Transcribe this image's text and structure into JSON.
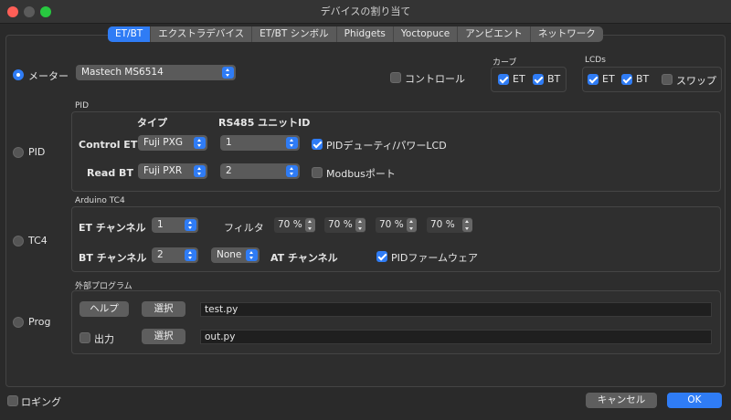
{
  "window": {
    "title": "デバイスの割り当て"
  },
  "tabs": [
    {
      "label": "ET/BT",
      "active": true
    },
    {
      "label": "エクストラデバイス"
    },
    {
      "label": "ET/BT シンボル"
    },
    {
      "label": "Phidgets"
    },
    {
      "label": "Yoctopuce"
    },
    {
      "label": "アンビエント"
    },
    {
      "label": "ネットワーク"
    }
  ],
  "meter": {
    "label": "メーター",
    "selected": true,
    "value": "Mastech MS6514"
  },
  "control": {
    "label": "コントロール",
    "checked": false
  },
  "curve": {
    "title": "カーブ",
    "et": "ET",
    "bt": "BT"
  },
  "lcds": {
    "title": "LCDs",
    "et": "ET",
    "bt": "BT",
    "swap": "スワップ"
  },
  "pid": {
    "group_title": "PID",
    "radio_label": "PID",
    "type_header": "タイプ",
    "rs485_header": "RS485 ユニットID",
    "control_et_label": "Control ET",
    "control_et_type": "Fuji PXG",
    "control_et_unit": "1",
    "pid_duty_label": "PIDデューティ/パワーLCD",
    "read_bt_label": "Read BT",
    "read_bt_type": "Fuji PXR",
    "read_bt_unit": "2",
    "modbus_label": "Modbusポート"
  },
  "tc4": {
    "group_title": "Arduino TC4",
    "radio_label": "TC4",
    "et_channel_label": "ET チャンネル",
    "et_channel": "1",
    "filter_label": "フィルタ",
    "filters": [
      "70 %",
      "70 %",
      "70 %",
      "70 %"
    ],
    "bt_channel_label": "BT チャンネル",
    "bt_channel": "2",
    "at_channel": "None",
    "at_channel_label": "AT チャンネル",
    "pid_firmware_label": "PIDファームウェア"
  },
  "prog": {
    "group_title": "外部プログラム",
    "radio_label": "Prog",
    "help_button": "ヘルプ",
    "select_button_1": "選択",
    "file_1": "test.py",
    "output_label": "出力",
    "select_button_2": "選択",
    "file_2": "out.py"
  },
  "footer": {
    "logging": "ロギング",
    "cancel": "キャンセル",
    "ok": "OK"
  },
  "colors": {
    "accent": "#2f7cf5",
    "background": "#2a2a2a"
  }
}
